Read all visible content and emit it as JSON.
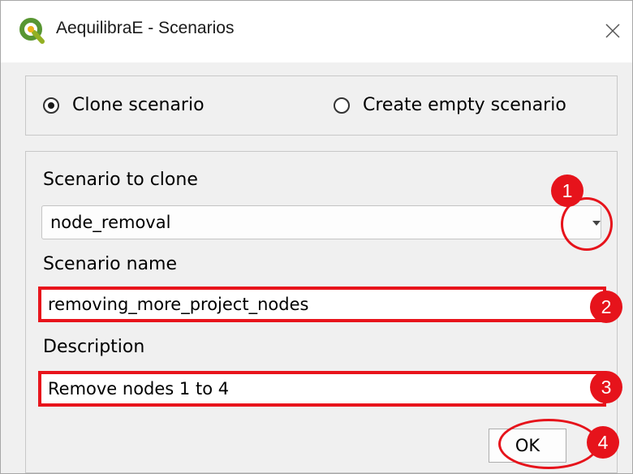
{
  "window": {
    "title": "AequilibraE - Scenarios",
    "close_glyph": "✕",
    "app_icon": "qgis-logo-icon"
  },
  "mode": {
    "options": [
      {
        "label": "Clone scenario",
        "checked": true
      },
      {
        "label": "Create empty scenario",
        "checked": false
      }
    ]
  },
  "form": {
    "scenario_to_clone_label": "Scenario to clone",
    "scenario_to_clone_value": "node_removal",
    "scenario_name_label": "Scenario name",
    "scenario_name_value": "removing_more_project_nodes",
    "description_label": "Description",
    "description_value": "Remove nodes 1 to 4"
  },
  "buttons": {
    "ok_label": "OK"
  },
  "annotations": {
    "markers": [
      "1",
      "2",
      "3",
      "4"
    ],
    "color": "#e6131b"
  }
}
